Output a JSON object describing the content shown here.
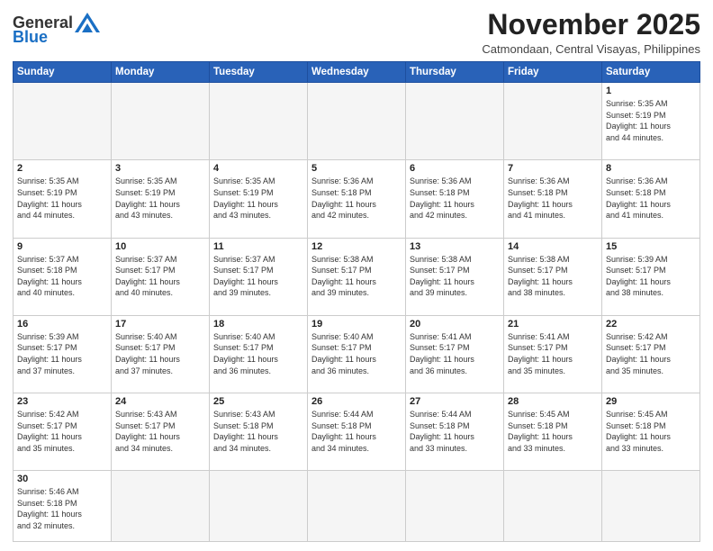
{
  "header": {
    "logo_general": "General",
    "logo_blue": "Blue",
    "month_title": "November 2025",
    "location": "Catmondaan, Central Visayas, Philippines"
  },
  "weekdays": [
    "Sunday",
    "Monday",
    "Tuesday",
    "Wednesday",
    "Thursday",
    "Friday",
    "Saturday"
  ],
  "weeks": [
    [
      {
        "day": "",
        "info": ""
      },
      {
        "day": "",
        "info": ""
      },
      {
        "day": "",
        "info": ""
      },
      {
        "day": "",
        "info": ""
      },
      {
        "day": "",
        "info": ""
      },
      {
        "day": "",
        "info": ""
      },
      {
        "day": "1",
        "info": "Sunrise: 5:35 AM\nSunset: 5:19 PM\nDaylight: 11 hours\nand 44 minutes."
      }
    ],
    [
      {
        "day": "2",
        "info": "Sunrise: 5:35 AM\nSunset: 5:19 PM\nDaylight: 11 hours\nand 44 minutes."
      },
      {
        "day": "3",
        "info": "Sunrise: 5:35 AM\nSunset: 5:19 PM\nDaylight: 11 hours\nand 43 minutes."
      },
      {
        "day": "4",
        "info": "Sunrise: 5:35 AM\nSunset: 5:19 PM\nDaylight: 11 hours\nand 43 minutes."
      },
      {
        "day": "5",
        "info": "Sunrise: 5:36 AM\nSunset: 5:18 PM\nDaylight: 11 hours\nand 42 minutes."
      },
      {
        "day": "6",
        "info": "Sunrise: 5:36 AM\nSunset: 5:18 PM\nDaylight: 11 hours\nand 42 minutes."
      },
      {
        "day": "7",
        "info": "Sunrise: 5:36 AM\nSunset: 5:18 PM\nDaylight: 11 hours\nand 41 minutes."
      },
      {
        "day": "8",
        "info": "Sunrise: 5:36 AM\nSunset: 5:18 PM\nDaylight: 11 hours\nand 41 minutes."
      }
    ],
    [
      {
        "day": "9",
        "info": "Sunrise: 5:37 AM\nSunset: 5:18 PM\nDaylight: 11 hours\nand 40 minutes."
      },
      {
        "day": "10",
        "info": "Sunrise: 5:37 AM\nSunset: 5:17 PM\nDaylight: 11 hours\nand 40 minutes."
      },
      {
        "day": "11",
        "info": "Sunrise: 5:37 AM\nSunset: 5:17 PM\nDaylight: 11 hours\nand 39 minutes."
      },
      {
        "day": "12",
        "info": "Sunrise: 5:38 AM\nSunset: 5:17 PM\nDaylight: 11 hours\nand 39 minutes."
      },
      {
        "day": "13",
        "info": "Sunrise: 5:38 AM\nSunset: 5:17 PM\nDaylight: 11 hours\nand 39 minutes."
      },
      {
        "day": "14",
        "info": "Sunrise: 5:38 AM\nSunset: 5:17 PM\nDaylight: 11 hours\nand 38 minutes."
      },
      {
        "day": "15",
        "info": "Sunrise: 5:39 AM\nSunset: 5:17 PM\nDaylight: 11 hours\nand 38 minutes."
      }
    ],
    [
      {
        "day": "16",
        "info": "Sunrise: 5:39 AM\nSunset: 5:17 PM\nDaylight: 11 hours\nand 37 minutes."
      },
      {
        "day": "17",
        "info": "Sunrise: 5:40 AM\nSunset: 5:17 PM\nDaylight: 11 hours\nand 37 minutes."
      },
      {
        "day": "18",
        "info": "Sunrise: 5:40 AM\nSunset: 5:17 PM\nDaylight: 11 hours\nand 36 minutes."
      },
      {
        "day": "19",
        "info": "Sunrise: 5:40 AM\nSunset: 5:17 PM\nDaylight: 11 hours\nand 36 minutes."
      },
      {
        "day": "20",
        "info": "Sunrise: 5:41 AM\nSunset: 5:17 PM\nDaylight: 11 hours\nand 36 minutes."
      },
      {
        "day": "21",
        "info": "Sunrise: 5:41 AM\nSunset: 5:17 PM\nDaylight: 11 hours\nand 35 minutes."
      },
      {
        "day": "22",
        "info": "Sunrise: 5:42 AM\nSunset: 5:17 PM\nDaylight: 11 hours\nand 35 minutes."
      }
    ],
    [
      {
        "day": "23",
        "info": "Sunrise: 5:42 AM\nSunset: 5:17 PM\nDaylight: 11 hours\nand 35 minutes."
      },
      {
        "day": "24",
        "info": "Sunrise: 5:43 AM\nSunset: 5:17 PM\nDaylight: 11 hours\nand 34 minutes."
      },
      {
        "day": "25",
        "info": "Sunrise: 5:43 AM\nSunset: 5:18 PM\nDaylight: 11 hours\nand 34 minutes."
      },
      {
        "day": "26",
        "info": "Sunrise: 5:44 AM\nSunset: 5:18 PM\nDaylight: 11 hours\nand 34 minutes."
      },
      {
        "day": "27",
        "info": "Sunrise: 5:44 AM\nSunset: 5:18 PM\nDaylight: 11 hours\nand 33 minutes."
      },
      {
        "day": "28",
        "info": "Sunrise: 5:45 AM\nSunset: 5:18 PM\nDaylight: 11 hours\nand 33 minutes."
      },
      {
        "day": "29",
        "info": "Sunrise: 5:45 AM\nSunset: 5:18 PM\nDaylight: 11 hours\nand 33 minutes."
      }
    ],
    [
      {
        "day": "30",
        "info": "Sunrise: 5:46 AM\nSunset: 5:18 PM\nDaylight: 11 hours\nand 32 minutes."
      },
      {
        "day": "",
        "info": ""
      },
      {
        "day": "",
        "info": ""
      },
      {
        "day": "",
        "info": ""
      },
      {
        "day": "",
        "info": ""
      },
      {
        "day": "",
        "info": ""
      },
      {
        "day": "",
        "info": ""
      }
    ]
  ]
}
